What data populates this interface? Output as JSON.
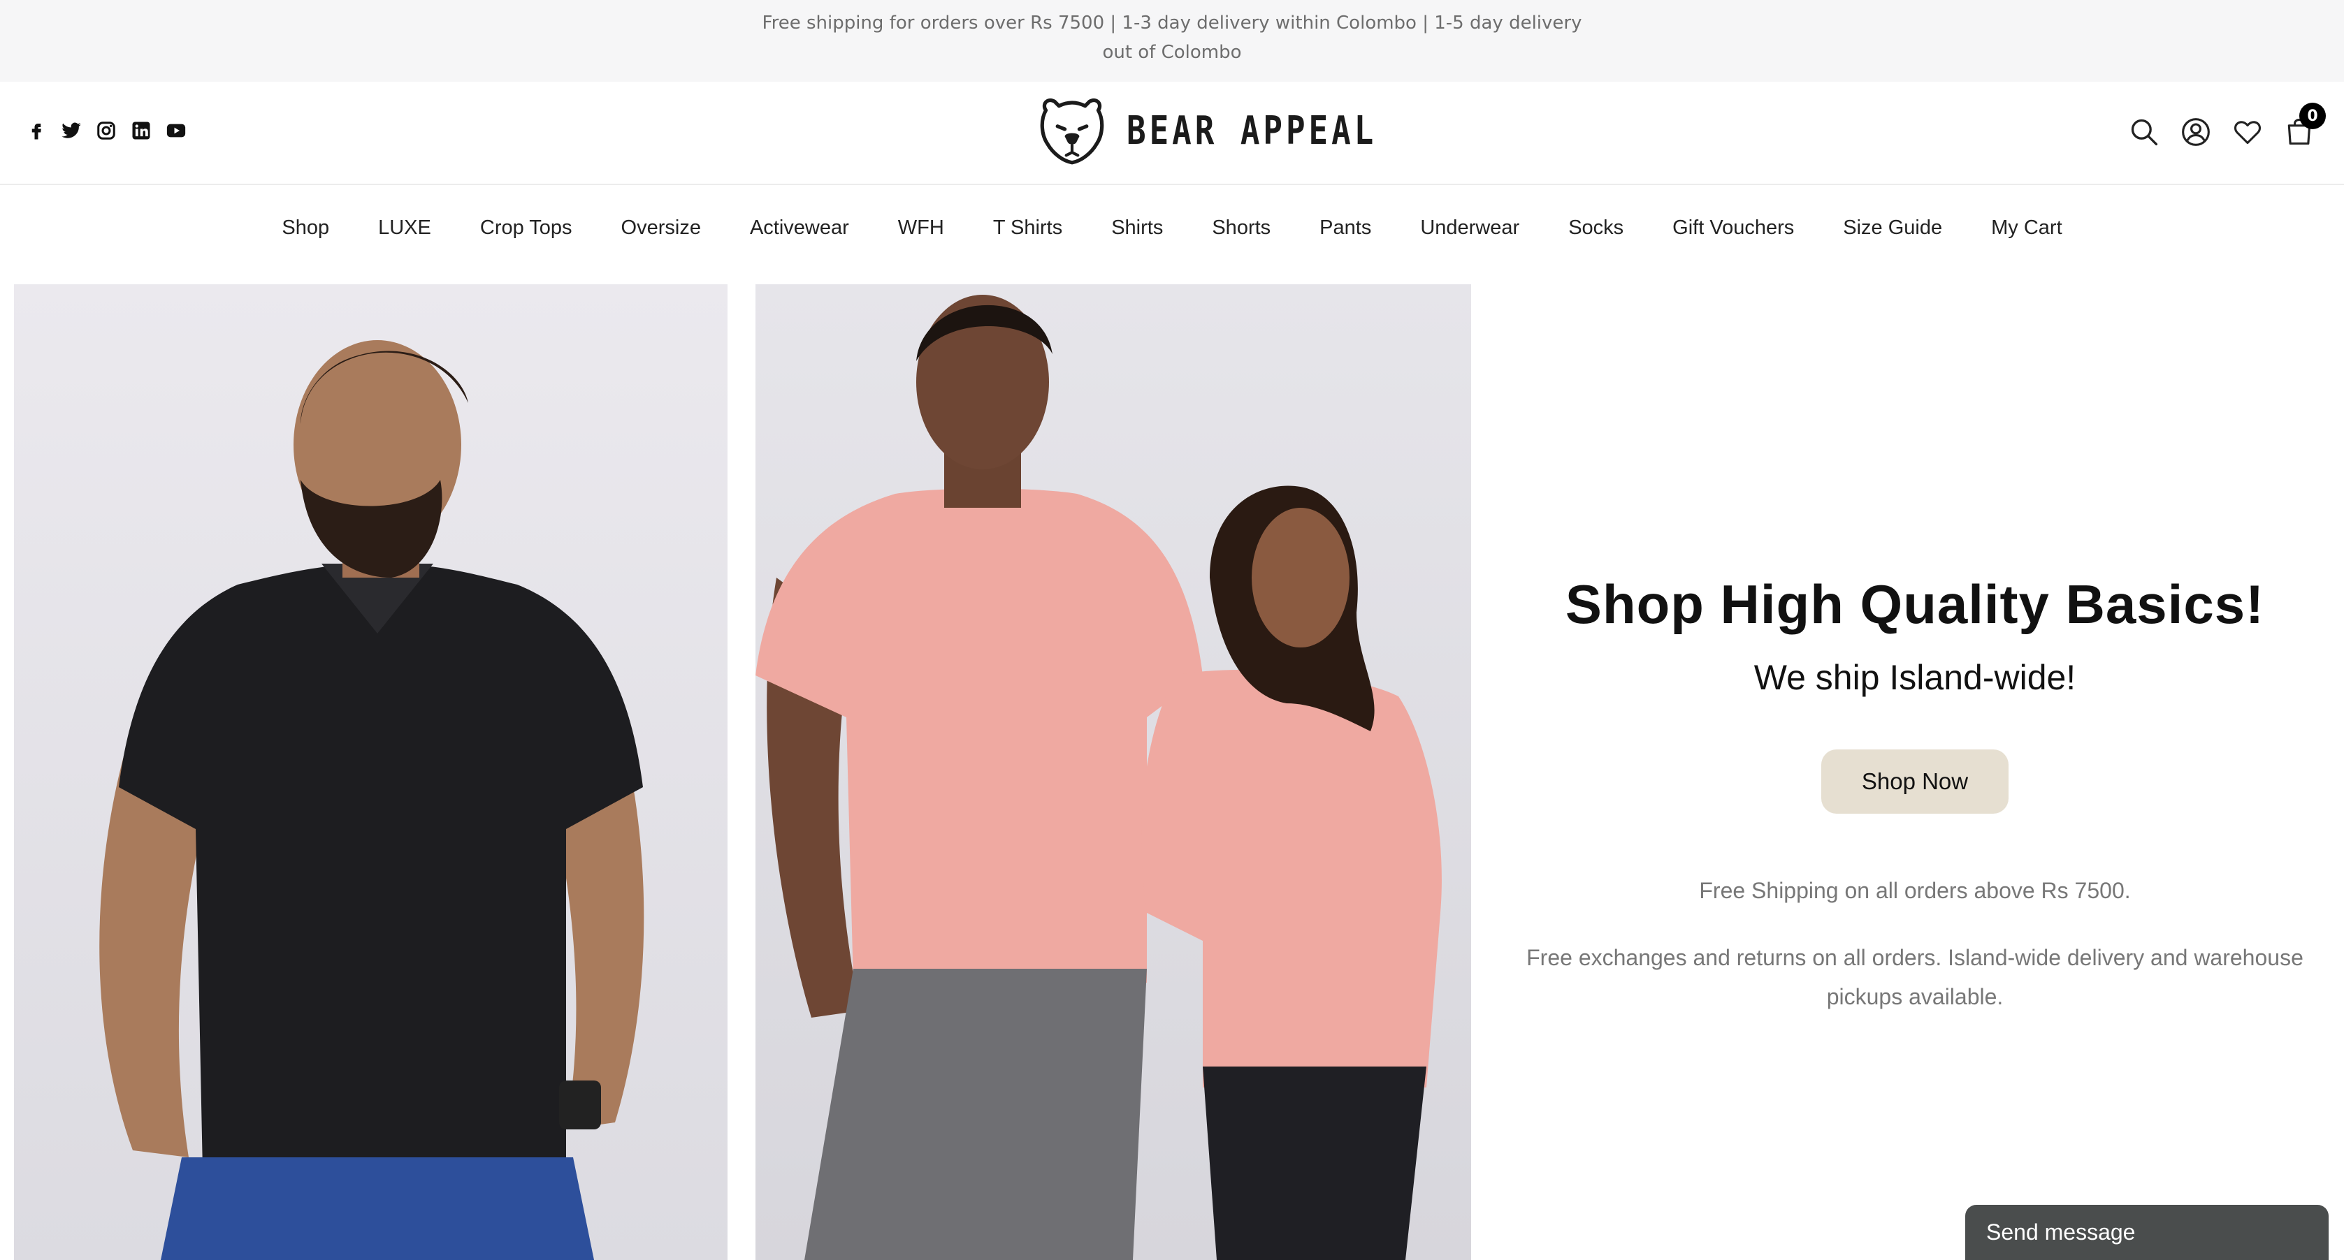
{
  "announcement": {
    "line1": "Free shipping for orders over Rs 7500 | 1-3 day delivery within Colombo | 1-5 day delivery",
    "line2": "out of Colombo"
  },
  "header": {
    "social_icons": [
      "facebook-icon",
      "twitter-icon",
      "instagram-icon",
      "linkedin-icon",
      "youtube-icon"
    ],
    "logo_text": "BEAR APPEAL",
    "tool_icons": [
      "search-icon",
      "account-icon",
      "wishlist-icon",
      "cart-icon"
    ],
    "cart_count": "0"
  },
  "nav": {
    "items": [
      "Shop",
      "LUXE",
      "Crop Tops",
      "Oversize",
      "Activewear",
      "WFH",
      "T Shirts",
      "Shirts",
      "Shorts",
      "Pants",
      "Underwear",
      "Socks",
      "Gift Vouchers",
      "Size Guide",
      "My Cart"
    ]
  },
  "promo": {
    "headline": "Shop High Quality Basics!",
    "subheadline": "We ship Island-wide!",
    "button_label": "Shop Now",
    "text1": "Free Shipping on all orders above Rs 7500.",
    "text2_line1": "Free exchanges and returns on all orders. Island-wide delivery and warehouse",
    "text2_line2": "pickups available."
  },
  "chat": {
    "label": "Send message"
  },
  "colors": {
    "announcement_bg": "#f6f6f7",
    "button_bg": "#e6dfd1",
    "chat_bg": "#4a4d4d",
    "shirt_pink": "#efa9a1",
    "shirt_black": "#1d1d20"
  }
}
